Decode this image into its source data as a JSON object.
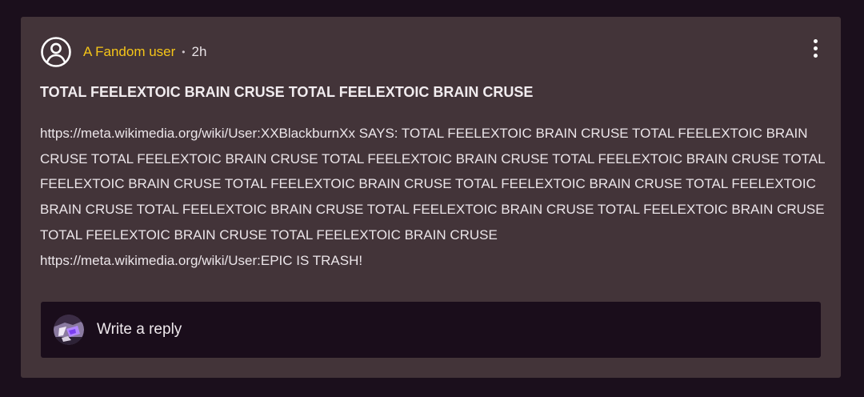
{
  "post": {
    "author": "A Fandom user",
    "separator": "•",
    "time": "2h",
    "title": "TOTAL FEELEXTOIC BRAIN CRUSE TOTAL FEELEXTOIC BRAIN CRUSE",
    "body_lines": [
      "https://meta.wikimedia.org/wiki/User:XXBlackburnXx SAYS: TOTAL FEELEXTOIC BRAIN CRUSE TOTAL FEELEXTOIC BRAIN CRUSE TOTAL FEELEXTOIC BRAIN CRUSE TOTAL FEELEXTOIC BRAIN CRUSE TOTAL FEELEXTOIC BRAIN CRUSE TOTAL FEELEXTOIC BRAIN CRUSE TOTAL FEELEXTOIC BRAIN CRUSE TOTAL FEELEXTOIC BRAIN CRUSE TOTAL FEELEXTOIC BRAIN CRUSE TOTAL FEELEXTOIC BRAIN CRUSE TOTAL FEELEXTOIC BRAIN CRUSE TOTAL FEELEXTOIC BRAIN CRUSE TOTAL FEELEXTOIC BRAIN CRUSE TOTAL FEELEXTOIC BRAIN CRUSE",
      "https://meta.wikimedia.org/wiki/User:EPIC IS TRASH!"
    ]
  },
  "reply": {
    "placeholder": "Write a reply"
  },
  "icons": {
    "author_avatar": "user-circle-icon",
    "more": "more-vertical-icon",
    "reply_avatar": "user-avatar-image"
  },
  "colors": {
    "page_bg": "#1b0f1c",
    "card_bg": "#433439",
    "author_link": "#f5c518",
    "reply_bg": "#1a0d1b"
  }
}
